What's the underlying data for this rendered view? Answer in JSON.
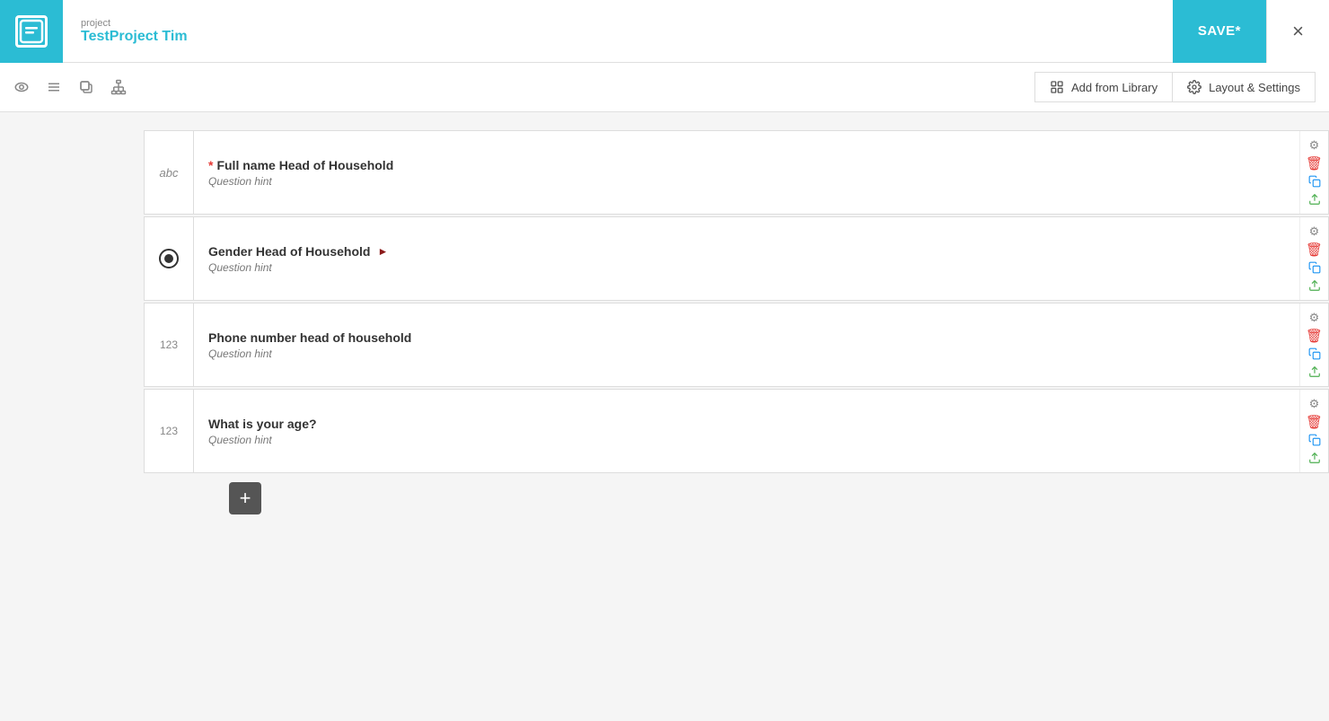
{
  "header": {
    "project_label": "project",
    "project_name": "TestProject",
    "project_user": " Tim",
    "save_button": "SAVE*",
    "close_button": "×"
  },
  "toolbar": {
    "library_button": "Add from Library",
    "layout_button": "Layout & Settings",
    "icons": [
      "eye-icon",
      "list-icon",
      "copy-icon",
      "hierarchy-icon"
    ]
  },
  "questions": [
    {
      "id": 1,
      "type_label": "abc",
      "type_icon": "text",
      "required": true,
      "label": "Full name Head of Household",
      "hint": "Question hint",
      "has_arrow": false
    },
    {
      "id": 2,
      "type_label": "radio",
      "type_icon": "radio",
      "required": false,
      "label": "Gender Head of Household",
      "hint": "Question hint",
      "has_arrow": true
    },
    {
      "id": 3,
      "type_label": "123",
      "type_icon": "number",
      "required": false,
      "label": "Phone number head of household",
      "hint": "Question hint",
      "has_arrow": false
    },
    {
      "id": 4,
      "type_label": "123",
      "type_icon": "number",
      "required": false,
      "label": "What is your age?",
      "hint": "Question hint",
      "has_arrow": false
    }
  ],
  "actions": {
    "gear": "⚙",
    "trash": "🗑",
    "copy": "⧉",
    "upload": "⬆",
    "add": "+"
  }
}
